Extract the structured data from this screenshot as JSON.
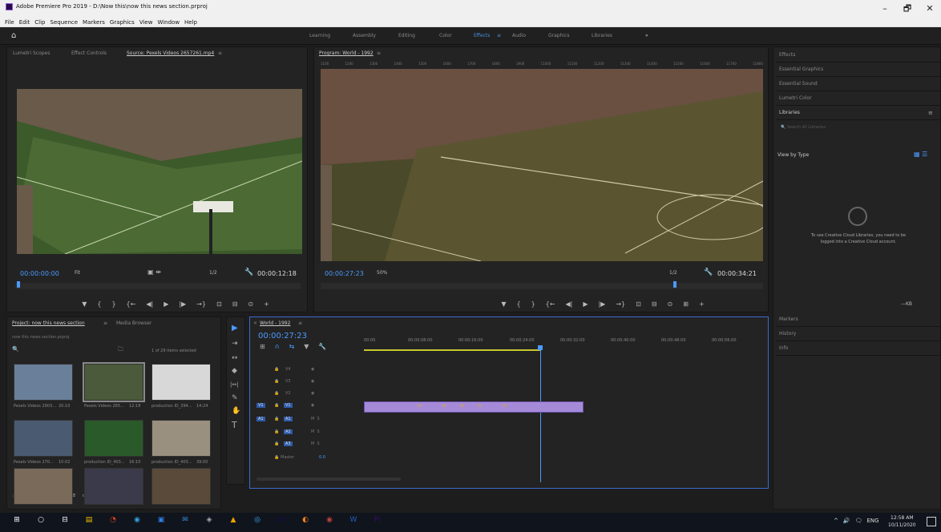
{
  "window": {
    "title": "Adobe Premiere Pro 2019 - D:\\Now this\\now this news section.prproj",
    "minimize": "–",
    "maximize": "🗗",
    "close": "✕"
  },
  "menu": [
    "File",
    "Edit",
    "Clip",
    "Sequence",
    "Markers",
    "Graphics",
    "View",
    "Window",
    "Help"
  ],
  "workspaces": {
    "items": [
      "Learning",
      "Assembly",
      "Editing",
      "Color",
      "Effects",
      "Audio",
      "Graphics",
      "Libraries"
    ],
    "active": "Effects",
    "more": "»",
    "menu_icon": "≡"
  },
  "source": {
    "tabs": [
      "Lumetri Scopes",
      "Effect Controls",
      "Source: Pexels Videos 2657261.mp4"
    ],
    "menu_icon": "≡",
    "timecode": "00:00:00:00",
    "fit": "Fit",
    "res": "1/2",
    "duration": "00:00:12:18"
  },
  "program": {
    "tab": "Program: World - 1992",
    "menu_icon": "≡",
    "timecode": "00:00:27:23",
    "zoom": "50%",
    "res": "1/2",
    "duration": "00:00:34:21",
    "ruler": [
      "1100",
      "1200",
      "1300",
      "1400",
      "1500",
      "1600",
      "1700",
      "1800",
      "1900",
      "11000",
      "11100",
      "11200",
      "11300",
      "11400",
      "11500",
      "11600",
      "11700",
      "11800"
    ]
  },
  "transport": {
    "source": [
      "▼",
      "{",
      "}",
      "{←",
      "◀|",
      "▶",
      "|▶",
      "→}",
      "⊡",
      "⊟",
      "⊙",
      "+"
    ],
    "program": [
      "▼",
      "{",
      "}",
      "{←",
      "◀|",
      "▶",
      "|▶",
      "→}",
      "⊡",
      "⊟",
      "⊙",
      "⊞",
      "+"
    ]
  },
  "project": {
    "tabs": [
      "Project: now this news section",
      "Media Browser"
    ],
    "menu_icon": "≡",
    "filename": "now this news section.prproj",
    "items_selected": "1 of 29 items selected",
    "bin_icon": "🗀",
    "search_icon": "🔍",
    "items": [
      {
        "name": "Pexels Videos 2903...",
        "dur": "20:10",
        "color": "#6a7f9a"
      },
      {
        "name": "Pexels Videos 265...",
        "dur": "12:18",
        "color": "#4a5a3a"
      },
      {
        "name": "production ID_394...",
        "dur": "14:24",
        "color": "#d8d8d8"
      },
      {
        "name": "Pexels Videos 270...",
        "dur": "10:02",
        "color": "#4a5a70"
      },
      {
        "name": "production ID_403...",
        "dur": "16:10",
        "color": "#2a5a2a"
      },
      {
        "name": "production ID_403...",
        "dur": "39:00",
        "color": "#9a9080"
      },
      {
        "name": "",
        "dur": "",
        "color": "#7a6a5a"
      },
      {
        "name": "",
        "dur": "",
        "color": "#3a3a4a"
      },
      {
        "name": "",
        "dur": "",
        "color": "#5a4a3a"
      }
    ],
    "bottom_icons": [
      "🔒",
      "☰",
      "▦",
      "◎",
      "○",
      "≡",
      "▭",
      "🔍",
      "▬",
      "▪",
      "🗑"
    ]
  },
  "tools": [
    "▶",
    "⇥",
    "↔",
    "◆",
    "|↔|",
    "✎",
    "✋",
    "T"
  ],
  "timeline": {
    "tab": "World - 1992",
    "close_icon": "×",
    "menu_icon": "≡",
    "timecode": "00:00:27:23",
    "header_icons": [
      "⊞",
      "∩",
      "⇆",
      "▼",
      "🔧"
    ],
    "ruler": [
      "00:00",
      "00:00:08:00",
      "00:00:16:00",
      "00:00:24:00",
      "00:00:32:00",
      "00:00:40:00",
      "00:00:48:00",
      "00:00:56:00"
    ],
    "video_tracks": [
      "V4",
      "V3",
      "V2",
      "V1"
    ],
    "audio_tracks": [
      "A1",
      "A2",
      "A3"
    ],
    "master": "Master",
    "master_val": "0.0",
    "lock": "🔒",
    "eye": "◉",
    "fx": "fx"
  },
  "right": {
    "items": [
      "Effects",
      "Essential Graphics",
      "Essential Sound",
      "Lumetri Color",
      "Libraries"
    ],
    "libraries_menu": "≡",
    "search_placeholder": "Search All Libraries",
    "view_by": "View by Type",
    "message": "To use Creative Cloud Libraries, you need to be logged into a Creative Cloud account.",
    "lower": [
      "Markers",
      "History",
      "Info"
    ],
    "cc_kb": "—KB"
  },
  "taskbar": {
    "time": "12:58 AM",
    "date": "10/11/2020",
    "lang": "ENG",
    "icons": [
      "⊞",
      "○",
      "⊟",
      "▤",
      "◔",
      "◉",
      "▣",
      "✉",
      "◈",
      "▲",
      "◎",
      "Ae",
      "◐",
      "◉",
      "W",
      "Pr"
    ],
    "tray": [
      "^",
      "🔊",
      "🗨"
    ]
  }
}
